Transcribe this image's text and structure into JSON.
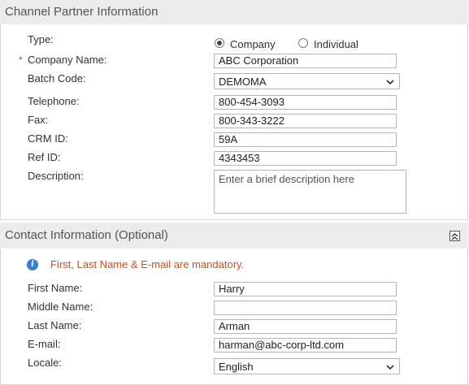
{
  "channel_partner": {
    "title": "Channel Partner Information",
    "type_label": "Type:",
    "type_options": [
      "Company",
      "Individual"
    ],
    "type_selected": "Company",
    "company_name_label": "Company Name:",
    "company_name_value": "ABC Corporation",
    "required_marker": "*",
    "batch_code_label": "Batch Code:",
    "batch_code_value": "DEMOMA",
    "telephone_label": "Telephone:",
    "telephone_value": "800-454-3093",
    "fax_label": "Fax:",
    "fax_value": "800-343-3222",
    "crm_id_label": "CRM ID:",
    "crm_id_value": "59A",
    "ref_id_label": "Ref ID:",
    "ref_id_value": "4343453",
    "description_label": "Description:",
    "description_placeholder": "Enter a brief description here"
  },
  "contact": {
    "title": "Contact Information (Optional)",
    "notice": "First, Last Name & E-mail are mandatory.",
    "first_name_label": "First Name:",
    "first_name_value": "Harry",
    "middle_name_label": "Middle Name:",
    "middle_name_value": "",
    "last_name_label": "Last Name:",
    "last_name_value": "Arman",
    "email_label": "E-mail:",
    "email_value": "harman@abc-corp-ltd.com",
    "locale_label": "Locale:",
    "locale_value": "English"
  },
  "icons": {
    "collapse": "collapse-up-icon",
    "info": "info-icon",
    "dropdown": "chevron-down-icon"
  },
  "colors": {
    "header_bg": "#ececec",
    "required": "#c0392b",
    "notice": "#c0501e",
    "info_icon": "#3a7dc9"
  }
}
